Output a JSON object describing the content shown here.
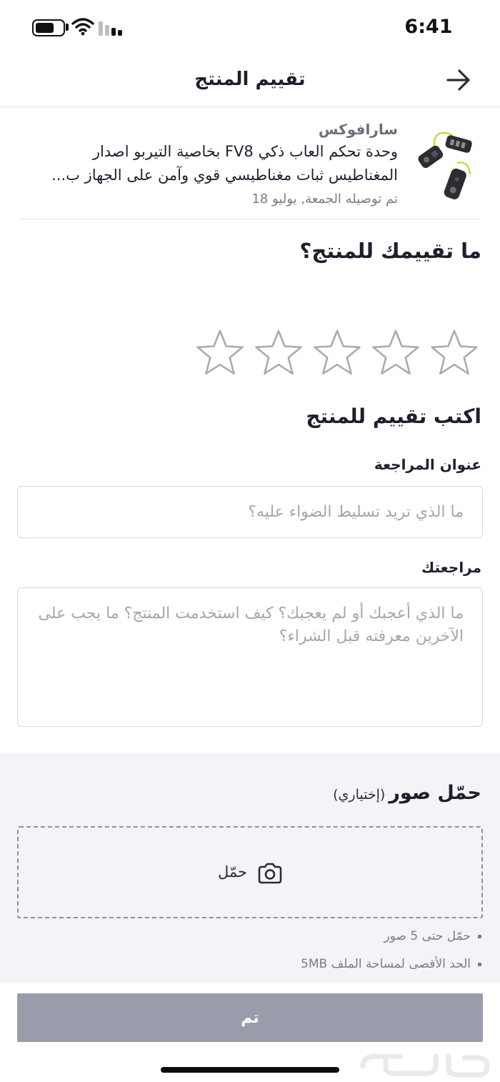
{
  "status_bar": {
    "time": "6:41",
    "battery_level": 0.7
  },
  "header": {
    "title": "تقييم المنتج",
    "back_icon": "arrow-right-icon"
  },
  "product": {
    "brand": "سارافوكس",
    "name": "وحدة تحكم العاب ذكي FV8 بخاصية التيربو اصدار المغناطيس ثبات مغناطيسي قوي وآمن على الجهاز ب...",
    "delivery": "تم توصيله الجمعة, يوليو 18"
  },
  "rating": {
    "question": "ما تقييمك للمنتج؟",
    "max_stars": 5,
    "value": 0,
    "star_icon": "star-outline-icon"
  },
  "review": {
    "heading": "اكتب تقييم للمنتج",
    "title_label": "عنوان المراجعة",
    "title_placeholder": "ما الذي تريد تسليط الضواء عليه؟",
    "body_label": "مراجعتك",
    "body_placeholder": "ما الذي أعجبك أو لم يعجبك؟ كيف استخدمت المنتج؟ ما يجب على الآخرين معرفته قبل الشراء؟"
  },
  "upload": {
    "title": "حمّل صور",
    "optional": "(إختياري)",
    "button_label": "حمّل",
    "icon": "camera-icon",
    "notes": [
      "حمّل حتى 5 صور",
      "الحد الأقصى لمساحة الملف 5MB"
    ]
  },
  "done_button": {
    "label": "تم"
  },
  "colors": {
    "button_disabled": "#9a9cab",
    "upload_bg": "#f3f4f8",
    "star_stroke": "#a9aab3"
  }
}
